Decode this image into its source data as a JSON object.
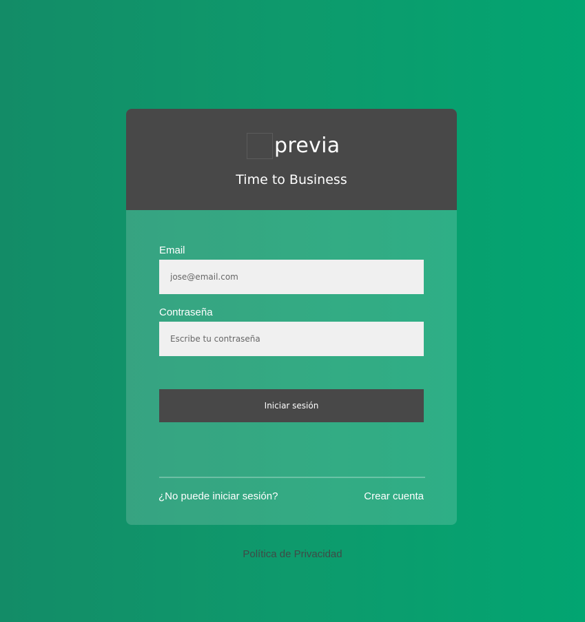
{
  "brand": {
    "logo_text": "previa",
    "tagline": "Time to Business"
  },
  "form": {
    "email_label": "Email",
    "email_placeholder": "jose@email.com",
    "password_label": "Contraseña",
    "password_placeholder": "Escribe tu contraseña",
    "submit_label": "Iniciar sesión"
  },
  "links": {
    "forgot": "¿No puede iniciar sesión?",
    "create_account": "Crear cuenta",
    "privacy": "Política de Privacidad"
  },
  "colors": {
    "header_bg": "#484848",
    "button_bg": "#484848",
    "input_bg": "#f0f0f0",
    "page_gradient_start": "#138c67",
    "page_gradient_end": "#02a571"
  }
}
